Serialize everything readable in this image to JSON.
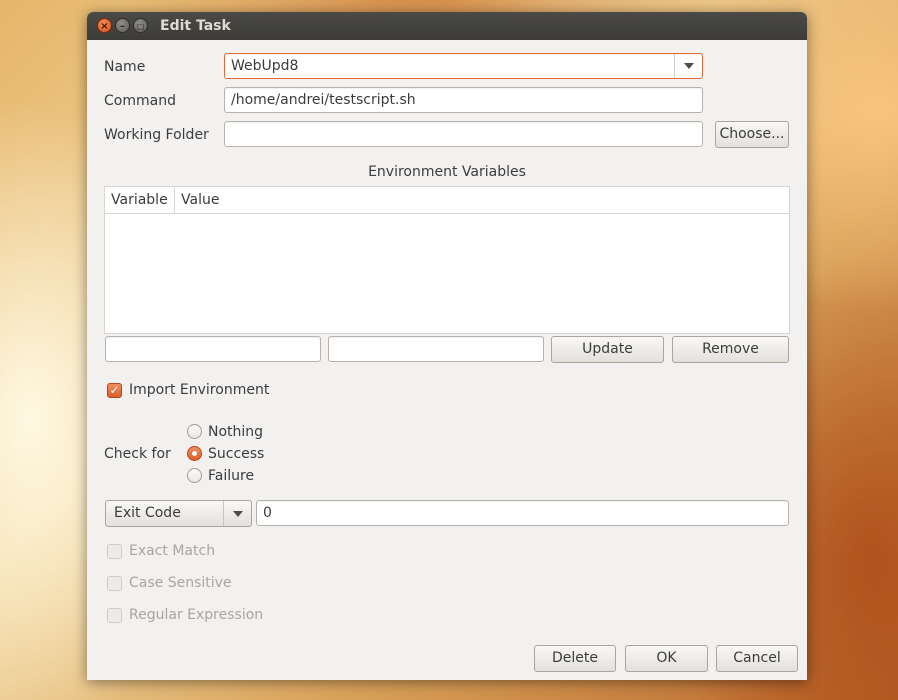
{
  "window": {
    "title": "Edit Task"
  },
  "form": {
    "name_label": "Name",
    "name_value": "WebUpd8",
    "command_label": "Command",
    "command_value": "/home/andrei/testscript.sh",
    "working_folder_label": "Working Folder",
    "working_folder_value": "",
    "choose_button": "Choose..."
  },
  "env": {
    "section_title": "Environment Variables",
    "columns": [
      "Variable",
      "Value"
    ],
    "rows": [],
    "variable_input": "",
    "value_input": "",
    "update_button": "Update",
    "remove_button": "Remove",
    "import_environment_label": "Import Environment",
    "import_environment_checked": true
  },
  "check": {
    "label": "Check for",
    "options": [
      "Nothing",
      "Success",
      "Failure"
    ],
    "selected": "Success",
    "type_selected": "Exit Code",
    "value": "0",
    "exact_match_label": "Exact Match",
    "case_sensitive_label": "Case Sensitive",
    "regex_label": "Regular Expression"
  },
  "buttons": {
    "delete": "Delete",
    "ok": "OK",
    "cancel": "Cancel"
  },
  "colors": {
    "accent": "#e06a3a",
    "titlebar": "#3c3b37",
    "window_bg": "#f2f1f0"
  }
}
